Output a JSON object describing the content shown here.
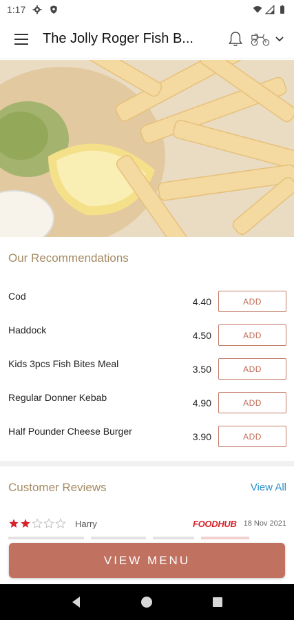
{
  "status_bar": {
    "time": "1:17",
    "left_icons": [
      "settings-icon",
      "shield-icon"
    ],
    "right_icons": [
      "wifi-icon",
      "signal-icon",
      "battery-icon"
    ]
  },
  "app_bar": {
    "title": "The Jolly Roger Fish B...",
    "icons": [
      "menu-icon",
      "bell-icon",
      "delivery-scooter-icon",
      "chevron-down-icon"
    ]
  },
  "hero": {
    "icon": "food-photo-fish-and-chips"
  },
  "recommendations": {
    "title": "Our Recommendations",
    "add_label": "ADD",
    "items": [
      {
        "name": "Cod",
        "price": "4.40"
      },
      {
        "name": "Haddock",
        "price": "4.50"
      },
      {
        "name": "Kids 3pcs Fish Bites Meal",
        "price": "3.50"
      },
      {
        "name": "Regular Donner Kebab",
        "price": "4.90"
      },
      {
        "name": "Half Pounder Cheese Burger",
        "price": "3.90"
      }
    ]
  },
  "reviews": {
    "title": "Customer Reviews",
    "view_all": "View All",
    "items": [
      {
        "rating": 2,
        "max_rating": 5,
        "reviewer": "Harry",
        "source": "FOODHUB",
        "date": "18 Nov 2021"
      }
    ]
  },
  "cta": {
    "label": "VIEW MENU"
  },
  "colors": {
    "accent": "#c0715f",
    "section_title": "#a48b64",
    "link": "#2a8fc9",
    "star": "#d8232a"
  },
  "nav_bar": {
    "icons": [
      "back-icon",
      "home-icon",
      "recents-icon"
    ]
  }
}
